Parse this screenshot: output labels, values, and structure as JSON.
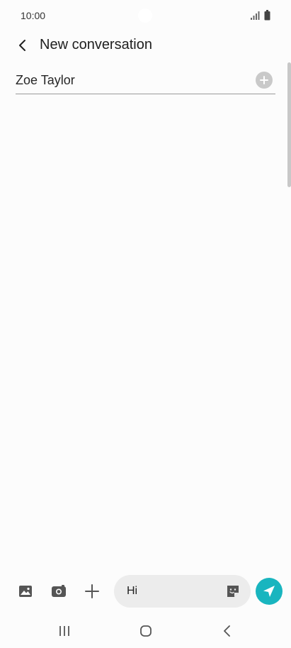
{
  "status_bar": {
    "time": "10:00",
    "icons": [
      "signal-icon",
      "battery-icon"
    ]
  },
  "header": {
    "title": "New conversation",
    "back_icon": "chevron-left-icon"
  },
  "recipient": {
    "value": "Zoe Taylor",
    "add_icon": "plus-circle-icon"
  },
  "composer": {
    "message_value": "Hi",
    "icons": [
      "gallery-icon",
      "camera-icon",
      "plus-icon",
      "sticker-icon",
      "send-icon"
    ]
  },
  "nav_bar": {
    "icons": [
      "recents-icon",
      "home-icon",
      "back-icon"
    ]
  },
  "colors": {
    "accent": "#19b5bf",
    "background": "#fcfcfc",
    "input_background": "#ececec"
  }
}
